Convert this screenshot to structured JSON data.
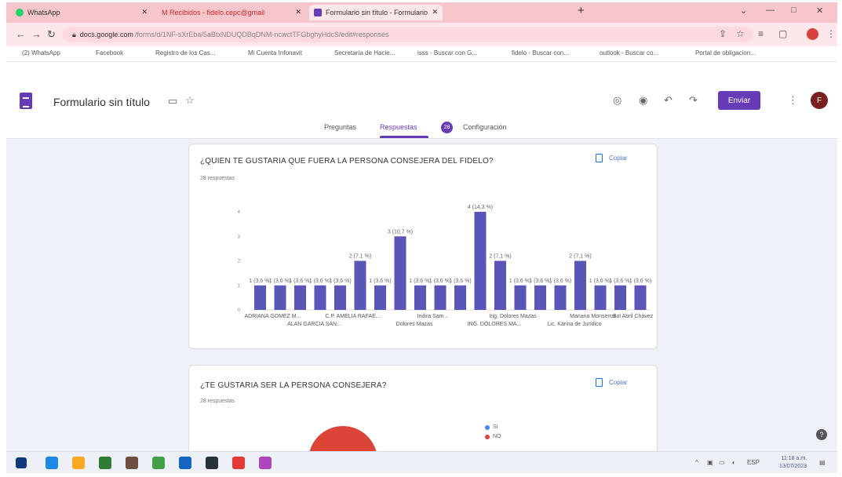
{
  "browser": {
    "tabs": [
      {
        "label": "WhatsApp",
        "close": "✕"
      },
      {
        "label": "M  Recibidos - fidelo.cepc@gmail",
        "close": "✕"
      },
      {
        "label": "Formulario sin título - Formulario",
        "close": "✕"
      }
    ],
    "new_tab": "+",
    "window_controls": [
      "⌄",
      "—",
      "□",
      "✕"
    ],
    "address_domain": "docs.google.com",
    "address_path": "/forms/d/1NF-sXrEba/5aBtxNDUQDBqDNM-ncwctTFGbghyHdcS/edit#responses",
    "bookmarks": [
      {
        "label": "(2) WhatsApp",
        "color": "#25d366"
      },
      {
        "label": "Facebook",
        "color": "#1877f2"
      },
      {
        "label": "Registro de los Cas...",
        "color": "#3f51b5"
      },
      {
        "label": "Mi Cuenta Infonavit",
        "color": "#c62828"
      },
      {
        "label": "Secretaría de Hacie...",
        "color": "#9e9e9e"
      },
      {
        "label": "isss - Buscar con G...",
        "color": "#455a64"
      },
      {
        "label": "fidelo - Buscar con...",
        "color": "#4285f4"
      },
      {
        "label": "outlook - Buscar co...",
        "color": "#4285f4"
      },
      {
        "label": "Portal de obligacion...",
        "color": "#7b1fa2"
      }
    ]
  },
  "form": {
    "title": "Formulario sin título",
    "send_label": "Enviar",
    "avatar_letter": "F",
    "subtabs": [
      "Preguntas",
      "Respuestas",
      "Configuración"
    ],
    "responses_badge": "28"
  },
  "question1": {
    "title": "¿QUIEN TE GUSTARIA QUE FUERA LA PERSONA CONSEJERA DEL FIDELO?",
    "count": "28 respuestas",
    "copy_label": "Copiar"
  },
  "question2": {
    "title": "¿TE GUSTARIA SER LA PERSONA CONSEJERA?",
    "count": "28 respuestas",
    "copy_label": "Copiar",
    "legend": [
      {
        "label": "SI",
        "color": "#4285f4"
      },
      {
        "label": "NO",
        "color": "#db4437"
      }
    ]
  },
  "chart_data": {
    "type": "bar",
    "values": [
      1,
      1,
      1,
      1,
      1,
      2,
      1,
      3,
      1,
      1,
      1,
      4,
      2,
      1,
      1,
      1,
      2,
      1,
      1,
      1
    ],
    "bar_labels": [
      "1 (3,6 %)",
      "1 (3,6 %)",
      "1 (3,6 %)",
      "1 (3,6 %)",
      "1 (3,6 %)",
      "2 (7,1 %)",
      "1 (3,6 %)",
      "3 (10,7 %)",
      "1 (3,6 %)",
      "1 (3,6 %)",
      "1 (3,6 %)",
      "4 (14,3 %)",
      "2 (7,1 %)",
      "1 (3,6 %)",
      "1 (3,6 %)",
      "1 (3,6 %)",
      "2 (7,1 %)",
      "1 (3,6 %)",
      "1 (3,6 %)",
      "1 (3,6 %)"
    ],
    "x_labels_row1": [
      "ADRIANA GOMEZ M...",
      "C.P. AMELIA RAFAE...",
      "Indira Sam...",
      "Ing. Dolores Mazas",
      "Mariana Monserrat",
      "Sol Abril Chávez"
    ],
    "x_labels_row2": [
      "ALAN GARCIA SAN...",
      "Dolores Mazas",
      "ING. DOLORES MA...",
      "Lic. Karina de Jurídico"
    ],
    "y_ticks": [
      "0",
      "1",
      "2",
      "3",
      "4"
    ],
    "ylim": [
      0,
      4
    ],
    "color": "#5a56b8"
  },
  "taskbar": {
    "apps": [
      "#1e88e5",
      "#f9a825",
      "#2e7d32",
      "#6d4c41",
      "#43a047",
      "#1565c0",
      "#263238",
      "#e53935",
      "#ab47bc"
    ],
    "tray": [
      "^",
      "ESP"
    ],
    "time": "11:18 a.m.",
    "date": "13/07/2023"
  }
}
